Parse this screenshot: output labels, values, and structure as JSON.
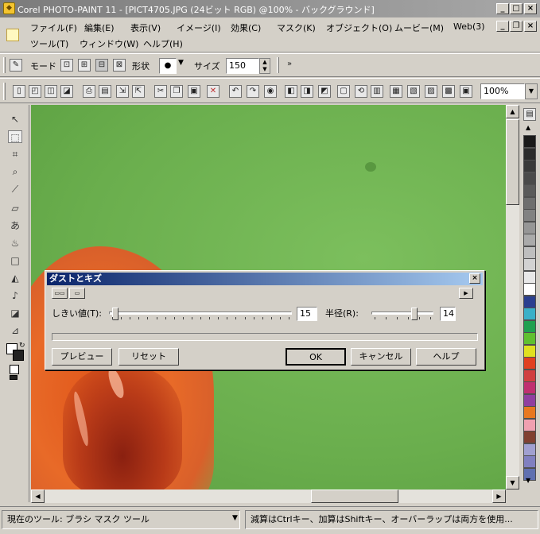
{
  "window": {
    "title": "Corel PHOTO-PAINT 11 - [PICT4705.JPG (24ビット RGB) @100% - バックグラウンド]"
  },
  "menu": {
    "items": [
      "ファイル(F)",
      "編集(E)",
      "表示(V)",
      "イメージ(I)",
      "効果(C)",
      "マスク(K)",
      "オブジェクト(O)",
      "ムービー(M)",
      "Web(3)",
      "ツール(T)",
      "ウィンドウ(W)",
      "ヘルプ(H)"
    ]
  },
  "property_bar": {
    "mode_label": "モード",
    "shape_label": "形状",
    "size_label": "サイズ",
    "size_value": "150"
  },
  "standard_bar": {
    "zoom_value": "100%"
  },
  "dialog": {
    "title": "ダストとキズ",
    "threshold_label": "しきい値(T):",
    "threshold_value": "15",
    "threshold_fraction": 0.02,
    "radius_label": "半径(R):",
    "radius_value": "14",
    "radius_fraction": 0.72,
    "preview_label": "プレビュー",
    "reset_label": "リセット",
    "ok_label": "OK",
    "cancel_label": "キャンセル",
    "help_label": "ヘルプ"
  },
  "palette": {
    "colors": [
      "#1a1a1a",
      "#2c2c2c",
      "#3a3a3a",
      "#4a4a4a",
      "#5a5a5a",
      "#6e6e6e",
      "#828282",
      "#969696",
      "#aaaaaa",
      "#bebebe",
      "#d2d2d2",
      "#e8e8e8",
      "#ffffff",
      "#2a3f8f",
      "#3ab0c8",
      "#20a050",
      "#60c030",
      "#e0e020",
      "#e04020",
      "#d04040",
      "#c03070",
      "#9040a0",
      "#e87820",
      "#f0a0b0",
      "#804030",
      "#a0a0d0",
      "#8080c0",
      "#6070b0"
    ]
  },
  "status": {
    "current_tool": "現在のツール: ブラシ マスク ツール",
    "hint": "減算はCtrlキー、加算はShiftキー、オーバーラップは両方を使用..."
  }
}
